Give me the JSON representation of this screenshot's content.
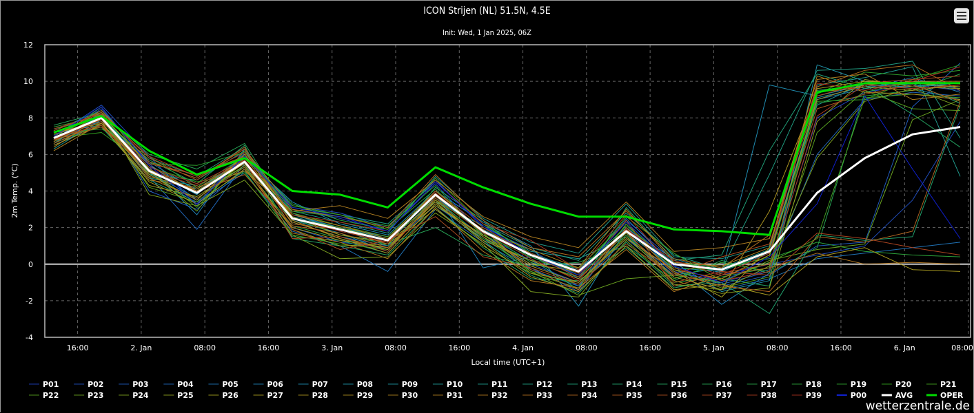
{
  "chart_data": {
    "type": "line",
    "title": "ICON Strijen (NL) 51.5N, 4.5E",
    "subtitle": "Init: Wed, 1 Jan 2025, 06Z",
    "xlabel": "Local time (UTC+1)",
    "ylabel": "2m Temp. (°C)",
    "ylim": [
      -4,
      12
    ],
    "yticks": [
      -4,
      -2,
      0,
      2,
      4,
      6,
      8,
      10,
      12
    ],
    "x_hours_from_first_point": [
      0,
      6,
      12,
      18,
      24,
      30,
      36,
      42,
      48,
      54,
      60,
      66,
      72,
      78,
      84,
      90,
      96,
      102,
      108,
      114
    ],
    "xtick_hours": [
      3,
      11,
      19,
      27,
      35,
      43,
      51,
      59,
      67,
      75,
      83,
      91,
      99,
      107,
      115
    ],
    "xtick_labels": [
      "16:00",
      "2. Jan",
      "08:00",
      "16:00",
      "3. Jan",
      "08:00",
      "16:00",
      "4. Jan",
      "08:00",
      "16:00",
      "5. Jan",
      "08:00",
      "16:00",
      "6. Jan",
      "08:00"
    ],
    "grid": true,
    "legend_placement": "bottom",
    "member_colors_gradient": [
      "#2040c0",
      "#2090b0",
      "#20a070",
      "#30a020",
      "#a8a020",
      "#b07020",
      "#a83020"
    ],
    "avg_color": "#ffffff",
    "oper_color": "#00dd00",
    "p00_color": "#1020d0",
    "series": [
      {
        "name": "P01",
        "values": [
          6.8,
          8.5,
          5.5,
          3.5,
          5.9,
          3.0,
          2.5,
          1.8,
          4.4,
          1.6,
          0.2,
          -1.2,
          2.2,
          -0.4,
          -1.0,
          -0.3,
          8.0,
          9.4,
          9.8,
          9.5
        ]
      },
      {
        "name": "P02",
        "values": [
          7.0,
          8.7,
          5.9,
          3.2,
          6.1,
          3.2,
          2.8,
          2.0,
          4.6,
          2.0,
          0.8,
          -0.8,
          2.4,
          0.2,
          -0.6,
          0.0,
          0.5,
          1.0,
          3.5,
          7.8
        ]
      },
      {
        "name": "P03",
        "values": [
          6.6,
          8.2,
          4.0,
          3.0,
          5.2,
          2.0,
          1.2,
          0.9,
          3.5,
          1.5,
          0.0,
          -1.0,
          1.6,
          -0.5,
          -1.2,
          -0.6,
          1.0,
          1.2,
          8.6,
          11.0
        ]
      },
      {
        "name": "P04",
        "values": [
          6.7,
          7.9,
          4.8,
          1.9,
          5.5,
          2.3,
          1.5,
          1.0,
          3.2,
          1.4,
          -0.2,
          -1.5,
          2.0,
          -0.3,
          -1.1,
          -0.4,
          6.0,
          9.0,
          9.4,
          9.2
        ]
      },
      {
        "name": "P05",
        "values": [
          6.5,
          7.7,
          5.0,
          3.3,
          5.0,
          1.8,
          1.0,
          -0.4,
          3.0,
          1.2,
          -0.3,
          -1.2,
          1.4,
          -0.7,
          -1.4,
          -0.8,
          0.3,
          0.6,
          0.9,
          1.2
        ]
      },
      {
        "name": "P06",
        "values": [
          6.9,
          8.0,
          5.3,
          2.7,
          6.3,
          2.7,
          2.0,
          1.5,
          3.9,
          -0.2,
          0.4,
          -0.6,
          2.5,
          -0.1,
          -2.2,
          -0.5,
          9.0,
          9.6,
          10.2,
          9.4
        ]
      },
      {
        "name": "P07",
        "values": [
          7.1,
          7.8,
          5.6,
          4.0,
          5.8,
          3.4,
          2.2,
          1.6,
          4.0,
          2.3,
          1.0,
          -2.3,
          1.9,
          0.3,
          -0.5,
          9.8,
          9.2,
          9.8,
          9.7,
          9.9
        ]
      },
      {
        "name": "P08",
        "values": [
          7.2,
          7.6,
          5.2,
          3.8,
          6.0,
          2.8,
          1.8,
          1.2,
          3.6,
          1.9,
          0.6,
          -0.3,
          2.0,
          0.1,
          -1.5,
          -0.9,
          10.9,
          10.0,
          9.6,
          9.0
        ]
      },
      {
        "name": "P09",
        "values": [
          6.8,
          8.1,
          5.4,
          4.1,
          5.7,
          2.4,
          1.7,
          0.7,
          3.7,
          1.7,
          0.5,
          -0.2,
          1.7,
          -0.2,
          -0.4,
          0.6,
          9.1,
          9.7,
          10.0,
          9.6
        ]
      },
      {
        "name": "P10",
        "values": [
          7.0,
          8.2,
          5.0,
          3.6,
          5.4,
          2.6,
          2.0,
          1.4,
          3.4,
          2.1,
          0.7,
          0.3,
          1.5,
          -0.6,
          -0.2,
          0.8,
          8.7,
          9.9,
          9.8,
          9.7
        ]
      },
      {
        "name": "P11",
        "values": [
          6.3,
          7.9,
          4.7,
          4.3,
          5.6,
          2.9,
          2.3,
          1.7,
          4.8,
          2.5,
          1.2,
          0.6,
          3.3,
          0.4,
          0.3,
          1.0,
          9.8,
          10.2,
          10.8,
          4.8
        ]
      },
      {
        "name": "P12",
        "values": [
          6.6,
          8.3,
          4.9,
          4.6,
          6.2,
          3.1,
          2.7,
          2.2,
          4.5,
          2.2,
          0.9,
          0.2,
          2.8,
          0.5,
          -0.3,
          4.9,
          10.6,
          10.7,
          11.1,
          6.9
        ]
      },
      {
        "name": "P13",
        "values": [
          7.3,
          8.4,
          5.8,
          4.8,
          6.4,
          2.2,
          1.9,
          1.0,
          4.2,
          2.4,
          0.3,
          -1.4,
          3.1,
          0.2,
          0.5,
          6.2,
          10.4,
          9.6,
          9.9,
          8.8
        ]
      },
      {
        "name": "P14",
        "values": [
          6.9,
          7.5,
          4.6,
          3.4,
          5.1,
          1.5,
          1.3,
          0.6,
          3.3,
          1.3,
          -0.6,
          -1.6,
          1.2,
          -1.2,
          -1.0,
          -2.7,
          1.6,
          1.3,
          1.5,
          8.7
        ]
      },
      {
        "name": "P15",
        "values": [
          7.4,
          8.0,
          5.7,
          4.4,
          6.5,
          1.4,
          1.0,
          0.5,
          3.1,
          0.9,
          -0.8,
          -0.9,
          0.9,
          -1.3,
          -0.8,
          -1.2,
          9.5,
          9.8,
          8.2,
          6.4
        ]
      },
      {
        "name": "P16",
        "values": [
          7.6,
          8.3,
          6.0,
          5.2,
          6.6,
          2.5,
          1.6,
          1.1,
          2.0,
          0.5,
          -0.1,
          0.1,
          1.0,
          -0.9,
          0.2,
          -0.5,
          0.9,
          9.4,
          10.0,
          9.9
        ]
      },
      {
        "name": "P17",
        "values": [
          6.6,
          7.7,
          5.1,
          4.0,
          5.3,
          2.1,
          1.4,
          0.8,
          3.8,
          1.8,
          0.1,
          -0.7,
          1.8,
          -1.0,
          -0.7,
          -0.2,
          8.8,
          9.2,
          9.5,
          10.4
        ]
      },
      {
        "name": "P18",
        "values": [
          7.1,
          7.4,
          5.9,
          4.2,
          5.9,
          3.3,
          2.4,
          1.9,
          4.1,
          1.6,
          0.4,
          -0.5,
          2.1,
          0.0,
          -0.1,
          0.3,
          1.2,
          0.7,
          0.5,
          0.4
        ]
      },
      {
        "name": "P19",
        "values": [
          7.5,
          8.1,
          5.5,
          5.4,
          6.1,
          2.9,
          2.6,
          2.1,
          4.3,
          1.5,
          -0.4,
          -1.1,
          1.6,
          -0.8,
          0.1,
          -0.4,
          9.3,
          10.5,
          10.3,
          10.6
        ]
      },
      {
        "name": "P20",
        "values": [
          6.9,
          7.2,
          5.3,
          4.5,
          5.0,
          1.6,
          1.1,
          0.8,
          3.6,
          1.4,
          0.2,
          -0.2,
          2.3,
          -0.2,
          -0.3,
          0.4,
          8.9,
          9.0,
          10.1,
          10.9
        ]
      },
      {
        "name": "P21",
        "values": [
          6.7,
          8.6,
          5.2,
          3.1,
          5.8,
          3.2,
          2.7,
          1.9,
          4.7,
          2.2,
          0.6,
          -0.6,
          2.6,
          0.6,
          -0.9,
          0.1,
          1.4,
          9.1,
          9.3,
          9.1
        ]
      },
      {
        "name": "P22",
        "values": [
          6.8,
          8.0,
          4.2,
          3.4,
          5.6,
          2.8,
          2.1,
          1.5,
          3.9,
          1.7,
          -0.5,
          -1.3,
          2.2,
          -0.3,
          -1.3,
          -0.7,
          7.2,
          9.5,
          8.5,
          8.4
        ]
      },
      {
        "name": "P23",
        "values": [
          6.9,
          7.9,
          5.1,
          2.9,
          6.2,
          2.5,
          2.0,
          1.3,
          3.5,
          1.9,
          -0.4,
          -1.7,
          -0.8,
          -0.6,
          -1.0,
          0.2,
          0.8,
          1.1,
          7.9,
          9.0
        ]
      },
      {
        "name": "P24",
        "values": [
          7.0,
          8.3,
          3.8,
          3.2,
          4.6,
          1.6,
          0.3,
          0.4,
          2.8,
          1.1,
          -1.5,
          -1.8,
          1.3,
          -1.1,
          -1.4,
          -0.1,
          5.8,
          8.9,
          9.6,
          8.6
        ]
      },
      {
        "name": "P25",
        "values": [
          6.6,
          7.8,
          4.3,
          3.7,
          5.4,
          1.9,
          1.0,
          1.1,
          3.0,
          1.0,
          -0.5,
          -1.0,
          1.5,
          -0.9,
          -1.6,
          -1.3,
          7.8,
          10.1,
          9.7,
          9.6
        ]
      },
      {
        "name": "P26",
        "values": [
          7.2,
          7.7,
          4.9,
          3.5,
          6.0,
          2.6,
          1.6,
          1.2,
          3.2,
          1.6,
          0.0,
          -0.4,
          1.9,
          -0.4,
          -1.8,
          0.9,
          9.6,
          10.0,
          9.9,
          9.7
        ]
      },
      {
        "name": "P27",
        "values": [
          6.5,
          7.6,
          4.5,
          3.3,
          5.2,
          2.0,
          1.3,
          0.9,
          3.4,
          1.2,
          -0.7,
          -1.5,
          1.0,
          -1.4,
          -1.1,
          -1.7,
          0.4,
          0.9,
          -0.3,
          -0.4
        ]
      },
      {
        "name": "P28",
        "values": [
          6.8,
          8.2,
          5.4,
          3.9,
          5.5,
          2.3,
          1.5,
          0.8,
          3.5,
          1.3,
          0.2,
          -0.8,
          1.7,
          -0.7,
          -1.4,
          2.9,
          9.4,
          9.7,
          9.5,
          9.8
        ]
      },
      {
        "name": "P29",
        "values": [
          7.1,
          7.9,
          5.0,
          4.0,
          5.7,
          2.4,
          1.4,
          0.6,
          3.3,
          1.5,
          -0.1,
          -1.0,
          1.4,
          -0.3,
          -0.8,
          0.5,
          9.0,
          9.8,
          10.0,
          10.0
        ]
      },
      {
        "name": "P30",
        "values": [
          6.4,
          8.1,
          4.8,
          4.1,
          5.8,
          2.7,
          2.1,
          1.4,
          4.0,
          1.8,
          0.8,
          -0.2,
          3.0,
          0.1,
          -0.1,
          0.9,
          10.3,
          9.4,
          9.3,
          9.0
        ]
      },
      {
        "name": "P31",
        "values": [
          6.2,
          7.7,
          4.6,
          4.2,
          5.1,
          2.9,
          3.2,
          2.5,
          4.6,
          2.6,
          1.5,
          0.9,
          3.4,
          0.7,
          0.9,
          1.4,
          10.1,
          10.4,
          9.0,
          9.3
        ]
      },
      {
        "name": "P32",
        "values": [
          6.7,
          8.0,
          4.7,
          3.6,
          5.3,
          1.7,
          1.2,
          0.3,
          3.1,
          0.7,
          -0.9,
          -1.3,
          0.8,
          -1.5,
          -0.6,
          -0.2,
          0.6,
          0.0,
          0.1,
          0.0
        ]
      },
      {
        "name": "P33",
        "values": [
          7.0,
          8.4,
          5.6,
          4.7,
          6.3,
          3.0,
          2.6,
          2.0,
          4.9,
          2.4,
          0.9,
          0.4,
          2.9,
          0.3,
          -0.2,
          1.6,
          9.7,
          10.6,
          10.9,
          9.5
        ]
      },
      {
        "name": "P34",
        "values": [
          6.8,
          7.5,
          5.2,
          4.0,
          4.9,
          2.1,
          1.7,
          0.9,
          3.7,
          1.9,
          -0.3,
          -1.4,
          2.0,
          -0.5,
          -1.2,
          -1.5,
          1.5,
          1.2,
          1.8,
          8.9
        ]
      },
      {
        "name": "P35",
        "values": [
          6.6,
          7.8,
          5.5,
          4.9,
          5.9,
          2.2,
          1.9,
          1.1,
          4.0,
          2.0,
          0.5,
          -0.7,
          2.4,
          -1.2,
          -0.5,
          0.0,
          8.5,
          9.3,
          9.8,
          8.9
        ]
      },
      {
        "name": "P36",
        "values": [
          7.3,
          8.3,
          5.8,
          4.6,
          6.4,
          1.9,
          0.8,
          1.3,
          2.6,
          0.4,
          -0.2,
          -1.1,
          1.1,
          -0.6,
          0.4,
          1.1,
          9.2,
          9.9,
          10.1,
          10.3
        ]
      },
      {
        "name": "P37",
        "values": [
          6.9,
          7.6,
          5.1,
          4.3,
          5.6,
          1.4,
          1.5,
          0.7,
          3.6,
          1.7,
          0.6,
          -0.5,
          1.8,
          -1.0,
          -0.4,
          -0.6,
          1.7,
          1.4,
          0.9,
          0.5
        ]
      },
      {
        "name": "P38",
        "values": [
          7.4,
          8.2,
          5.9,
          4.8,
          6.1,
          2.7,
          2.3,
          1.8,
          4.5,
          2.2,
          1.3,
          -0.3,
          2.7,
          -0.2,
          -0.9,
          -0.4,
          8.1,
          9.8,
          9.6,
          9.8
        ]
      },
      {
        "name": "P39",
        "values": [
          6.8,
          7.9,
          5.3,
          4.4,
          5.7,
          2.5,
          1.8,
          1.2,
          3.9,
          1.8,
          0.3,
          -0.9,
          1.9,
          0.2,
          -0.6,
          0.6,
          9.9,
          9.5,
          10.0,
          10.8
        ]
      },
      {
        "name": "P00",
        "values": [
          7.0,
          8.6,
          5.4,
          3.3,
          5.9,
          3.1,
          2.6,
          1.8,
          4.5,
          2.1,
          0.5,
          -0.6,
          2.3,
          -0.1,
          -1.0,
          0.4,
          3.3,
          9.2,
          5.2,
          1.4
        ]
      },
      {
        "name": "AVG",
        "values": [
          6.9,
          8.0,
          5.1,
          3.9,
          5.6,
          2.5,
          1.9,
          1.3,
          3.8,
          1.8,
          0.5,
          -0.4,
          1.8,
          0.0,
          -0.3,
          0.7,
          3.9,
          5.8,
          7.1,
          7.5
        ]
      },
      {
        "name": "OPER",
        "values": [
          7.2,
          8.1,
          6.2,
          4.9,
          5.8,
          4.0,
          3.8,
          3.1,
          5.3,
          4.2,
          3.3,
          2.6,
          2.6,
          1.9,
          1.8,
          1.6,
          9.4,
          9.9,
          9.9,
          9.9
        ]
      }
    ]
  },
  "menu_icon": "hamburger-menu-icon",
  "credit": "wetterzentrale.de"
}
